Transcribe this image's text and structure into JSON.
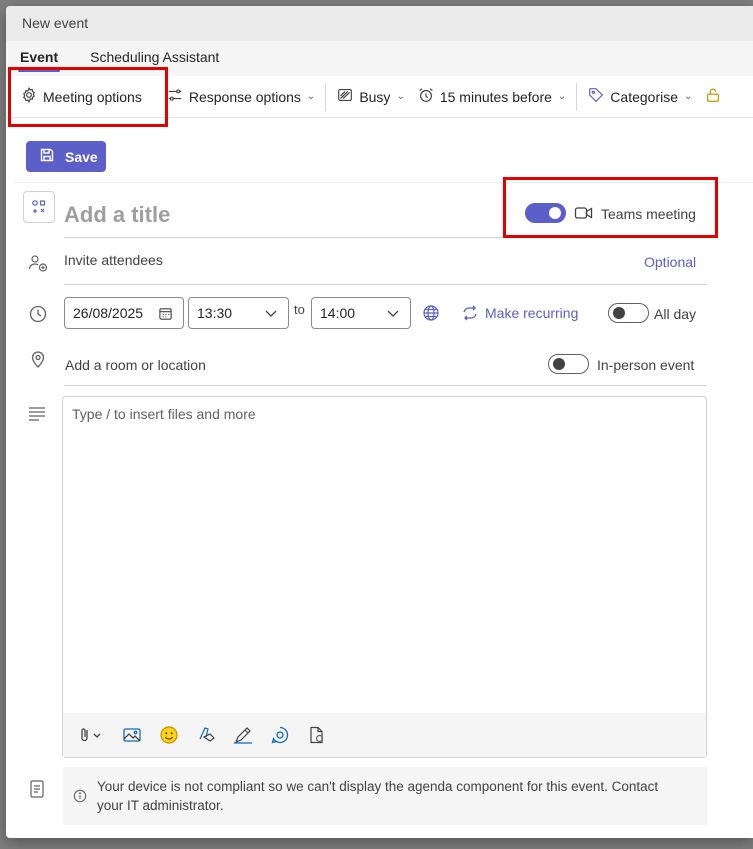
{
  "window": {
    "title": "New event"
  },
  "tabs": [
    {
      "label": "Event",
      "active": true
    },
    {
      "label": "Scheduling Assistant",
      "active": false
    }
  ],
  "toolbar": {
    "meeting_options": "Meeting options",
    "response_options": "Response options",
    "busy": "Busy",
    "reminder": "15 minutes before",
    "categorise": "Categorise"
  },
  "form": {
    "save_label": "Save",
    "title_placeholder": "Add a title",
    "teams_meeting_label": "Teams meeting",
    "teams_meeting_enabled": true,
    "invite_placeholder": "Invite attendees",
    "optional_label": "Optional",
    "start_date": "26/08/2025",
    "start_time": "13:30",
    "to_label": "to",
    "end_time": "14:00",
    "make_recurring": "Make recurring",
    "all_day_label": "All day",
    "all_day_enabled": false,
    "location_placeholder": "Add a room or location",
    "in_person_label": "In-person event",
    "in_person_enabled": false,
    "body_placeholder": "Type / to insert files and more",
    "notice_line1": "Your device is not compliant so we can't display the agenda component for this event. Contact",
    "notice_line2": "your IT administrator."
  },
  "colors": {
    "accent": "#5b5fc7",
    "highlight": "#e50000"
  },
  "icons": [
    "settings-icon",
    "sliders-icon",
    "busy-icon",
    "alarm-icon",
    "tag-icon",
    "lock-icon",
    "save-icon",
    "emoji-grid-icon",
    "video-icon",
    "people-add-icon",
    "clock-icon",
    "calendar-icon",
    "globe-icon",
    "repeat-icon",
    "location-icon",
    "text-lines-icon",
    "attach-icon",
    "image-icon",
    "emoji-icon",
    "highlighter-icon",
    "pen-icon",
    "loop-icon",
    "document-icon",
    "info-icon",
    "agenda-icon"
  ]
}
